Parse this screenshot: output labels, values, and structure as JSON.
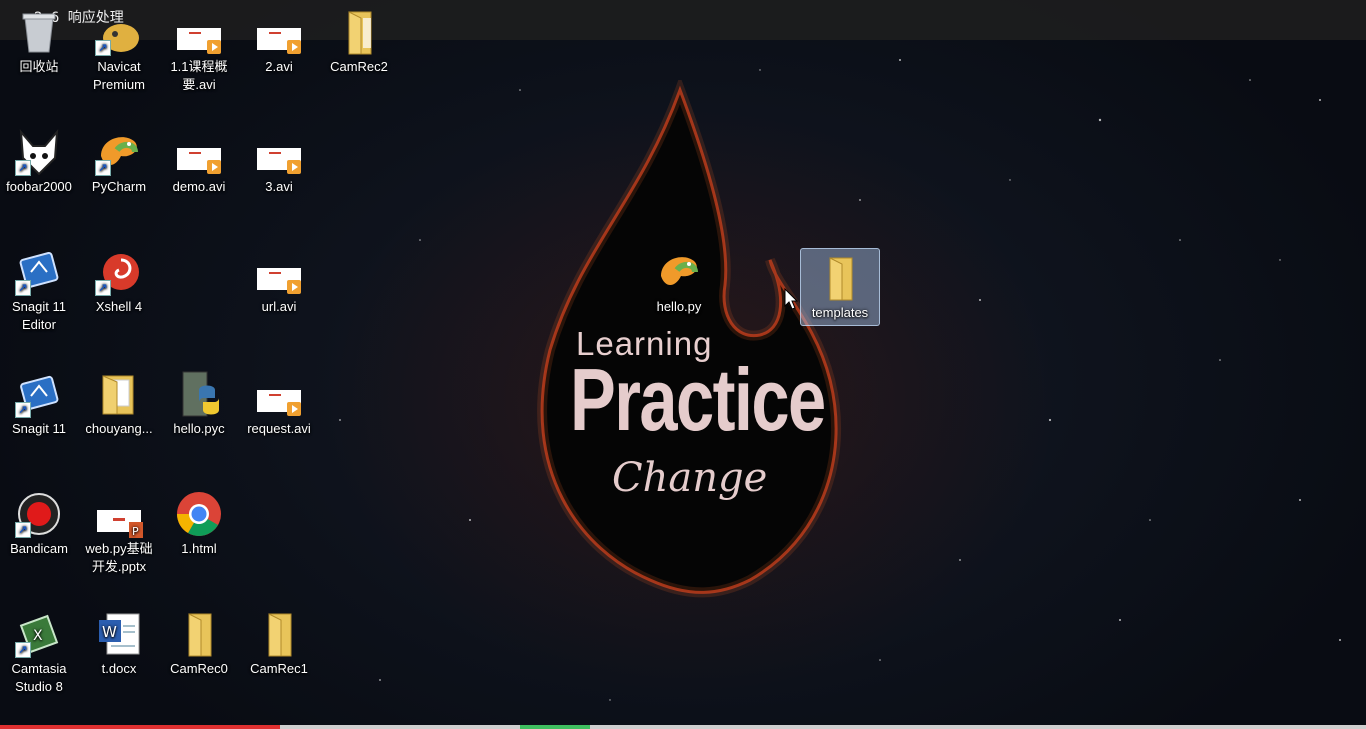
{
  "window": {
    "title": "2-6 响应处理"
  },
  "desktop": {
    "icons": [
      {
        "label": "回收站",
        "icon": "recycle-bin-icon"
      },
      {
        "label": "Navicat Premium",
        "icon": "navicat-icon"
      },
      {
        "label": "1.1课程概要.avi",
        "icon": "video-file-icon"
      },
      {
        "label": "2.avi",
        "icon": "video-file-icon"
      },
      {
        "label": "CamRec2",
        "icon": "folder-icon"
      },
      {
        "label": "foobar2000",
        "icon": "foobar2000-icon"
      },
      {
        "label": "PyCharm",
        "icon": "pycharm-icon"
      },
      {
        "label": "demo.avi",
        "icon": "video-file-icon"
      },
      {
        "label": "3.avi",
        "icon": "video-file-icon"
      },
      {
        "label": "Snagit 11 Editor",
        "icon": "snagit-editor-icon"
      },
      {
        "label": "Xshell 4",
        "icon": "xshell-icon"
      },
      {
        "label": "url.avi",
        "icon": "video-file-icon"
      },
      {
        "label": "Snagit 11",
        "icon": "snagit-icon"
      },
      {
        "label": "chouyang...",
        "icon": "folder-icon"
      },
      {
        "label": "hello.pyc",
        "icon": "python-file-icon"
      },
      {
        "label": "request.avi",
        "icon": "video-file-icon"
      },
      {
        "label": "Bandicam",
        "icon": "bandicam-icon"
      },
      {
        "label": "web.py基础开发.pptx",
        "icon": "pptx-file-icon"
      },
      {
        "label": "1.html",
        "icon": "chrome-icon"
      },
      {
        "label": "Camtasia Studio 8",
        "icon": "camtasia-icon"
      },
      {
        "label": "t.docx",
        "icon": "word-file-icon"
      },
      {
        "label": "CamRec0",
        "icon": "folder-icon"
      },
      {
        "label": "CamRec1",
        "icon": "folder-icon"
      },
      {
        "label": "hello.py",
        "icon": "pycharm-file-icon"
      },
      {
        "label": "templates",
        "icon": "folder-icon"
      }
    ]
  },
  "wallpaper": {
    "line1": "Learning",
    "line2": "Practice",
    "line3": "Change"
  },
  "colors": {
    "folder": "#e8c45a",
    "selection": "#aac8f0",
    "flame": "#c8401a"
  }
}
